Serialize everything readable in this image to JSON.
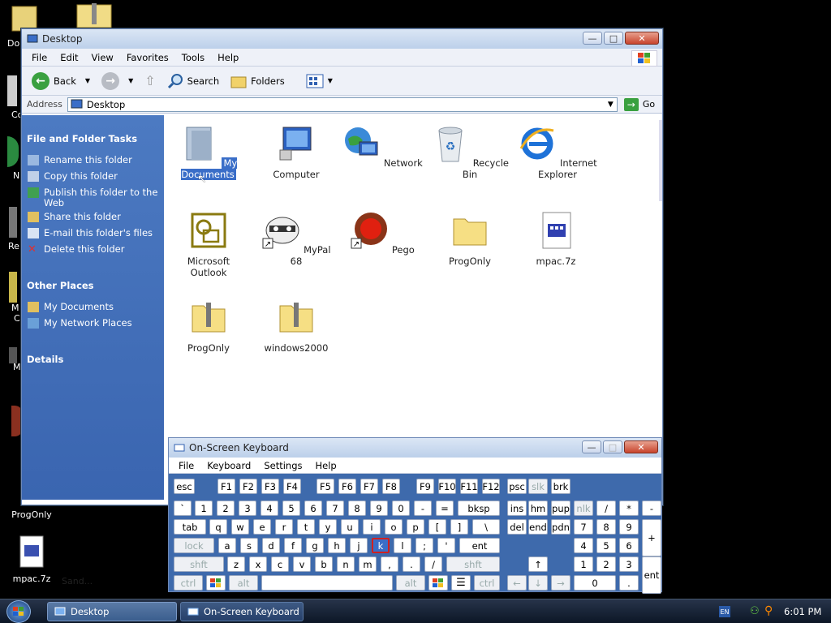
{
  "desktop": {
    "icons_left": [
      {
        "label": "Do"
      },
      {
        "label": "Co"
      },
      {
        "label": "N"
      },
      {
        "label": "Re"
      },
      {
        "label": "M"
      },
      {
        "label": "C"
      },
      {
        "label": "M"
      }
    ],
    "progonly": "ProgOnly",
    "mpac": "mpac.7z",
    "faded": "Sand..."
  },
  "explorer": {
    "title": "Desktop",
    "menu": [
      "File",
      "Edit",
      "View",
      "Favorites",
      "Tools",
      "Help"
    ],
    "toolbar": {
      "back": "Back",
      "search": "Search",
      "folders": "Folders"
    },
    "address_label": "Address",
    "address_value": "Desktop",
    "go": "Go",
    "tasks_header": "File and Folder Tasks",
    "tasks": [
      "Rename this folder",
      "Copy this folder",
      "Publish this folder to the Web",
      "Share this folder",
      "E-mail this folder's files",
      "Delete this folder"
    ],
    "other_header": "Other Places",
    "other": [
      "My Documents",
      "My Network Places"
    ],
    "details_header": "Details",
    "items": [
      "My Documents",
      "Computer",
      "Network",
      "Recycle Bin",
      "Internet Explorer",
      "Microsoft Outlook",
      "MyPal 68",
      "Pego",
      "ProgOnly",
      "mpac.7z",
      "ProgOnly",
      "windows2000"
    ]
  },
  "osk": {
    "title": "On-Screen Keyboard",
    "menu": [
      "File",
      "Keyboard",
      "Settings",
      "Help"
    ]
  },
  "taskbar": {
    "tasks": [
      "Desktop",
      "On-Screen Keyboard"
    ],
    "lang": "EN",
    "clock": "6:01 PM"
  }
}
